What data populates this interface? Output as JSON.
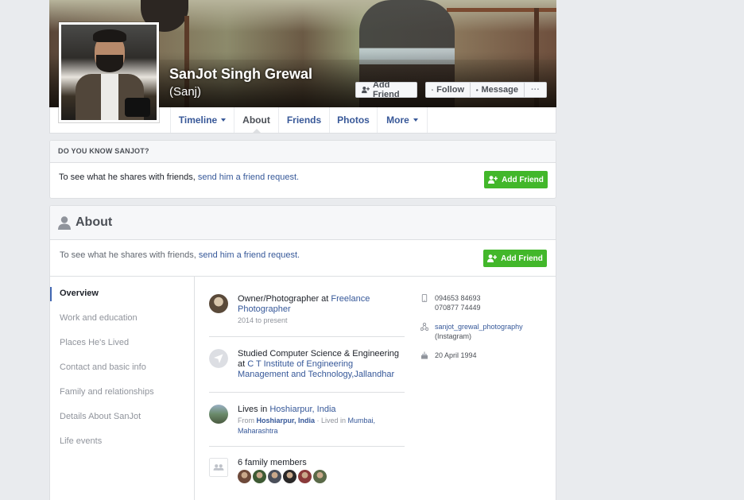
{
  "profile": {
    "name": "SanJot Singh Grewal",
    "nickname": "(Sanj)"
  },
  "cover_actions": {
    "add_friend": "Add Friend",
    "follow": "Follow",
    "message": "Message",
    "more": "···"
  },
  "tabs": [
    {
      "label": "Timeline",
      "has_caret": true
    },
    {
      "label": "About",
      "active": true
    },
    {
      "label": "Friends"
    },
    {
      "label": "Photos"
    },
    {
      "label": "More",
      "has_caret": true
    }
  ],
  "know_card": {
    "header": "DO YOU KNOW SANJOT?",
    "text_prefix": "To see what he shares with friends, ",
    "text_link": "send him a friend request.",
    "button": "Add Friend"
  },
  "about": {
    "title": "About",
    "sub_prefix": "To see what he shares with friends, ",
    "sub_link": "send him a friend request.",
    "button": "Add Friend",
    "nav": [
      {
        "label": "Overview",
        "active": true
      },
      {
        "label": "Work and education"
      },
      {
        "label": "Places He's Lived"
      },
      {
        "label": "Contact and basic info"
      },
      {
        "label": "Family and relationships"
      },
      {
        "label": "Details About SanJot"
      },
      {
        "label": "Life events"
      }
    ],
    "work": {
      "prefix": "Owner/Photographer at ",
      "link": "Freelance Photographer",
      "sub": "2014 to present"
    },
    "education": {
      "prefix": "Studied Computer Science & Engineering at ",
      "link": "C T Institute of Engineering Management and Technology,Jallandhar"
    },
    "lives": {
      "prefix": "Lives in ",
      "link": "Hoshiarpur, India",
      "from_label": "From ",
      "from_link": "Hoshiarpur, India",
      "lived_label": " · Lived in ",
      "lived_link": "Mumbai, Maharashtra"
    },
    "family": {
      "label": "6 family members",
      "avatar_colors": [
        "#6e4a3a",
        "#3e5a34",
        "#4a4f5a",
        "#2a2828",
        "#8a3a3a",
        "#5a6a48"
      ]
    },
    "contact": {
      "phone1": "094653 84693",
      "phone2": "070877 74449",
      "instagram": "sanjot_grewal_photography",
      "instagram_suffix": " (Instagram)",
      "birthday": "20 April 1994"
    }
  },
  "colors": {
    "brand_blue": "#365899",
    "green": "#42b72a",
    "page_bg": "#e9ebee"
  }
}
